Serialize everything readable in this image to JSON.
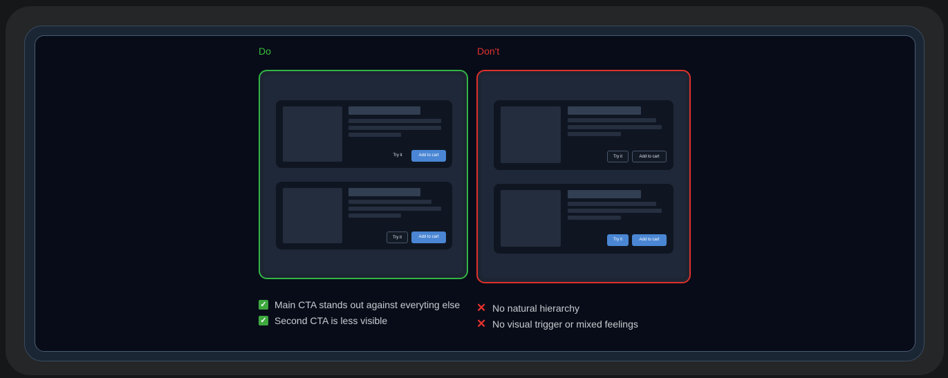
{
  "do": {
    "heading": "Do",
    "cards": [
      {
        "secondary_label": "Try it",
        "primary_label": "Add to cart"
      },
      {
        "secondary_label": "Try it",
        "primary_label": "Add to cart"
      }
    ],
    "notes": [
      "Main CTA stands out against everyting else",
      "Second CTA is less visible"
    ]
  },
  "dont": {
    "heading": "Don't",
    "cards": [
      {
        "secondary_label": "Try it",
        "primary_label": "Add to cart"
      },
      {
        "secondary_label": "Try it",
        "primary_label": "Add to cart"
      }
    ],
    "notes": [
      "No natural hierarchy",
      "No visual trigger or mixed feelings"
    ]
  },
  "colors": {
    "do_accent": "#33b545",
    "dont_accent": "#e0302c",
    "cta_blue": "#4a86d4"
  }
}
